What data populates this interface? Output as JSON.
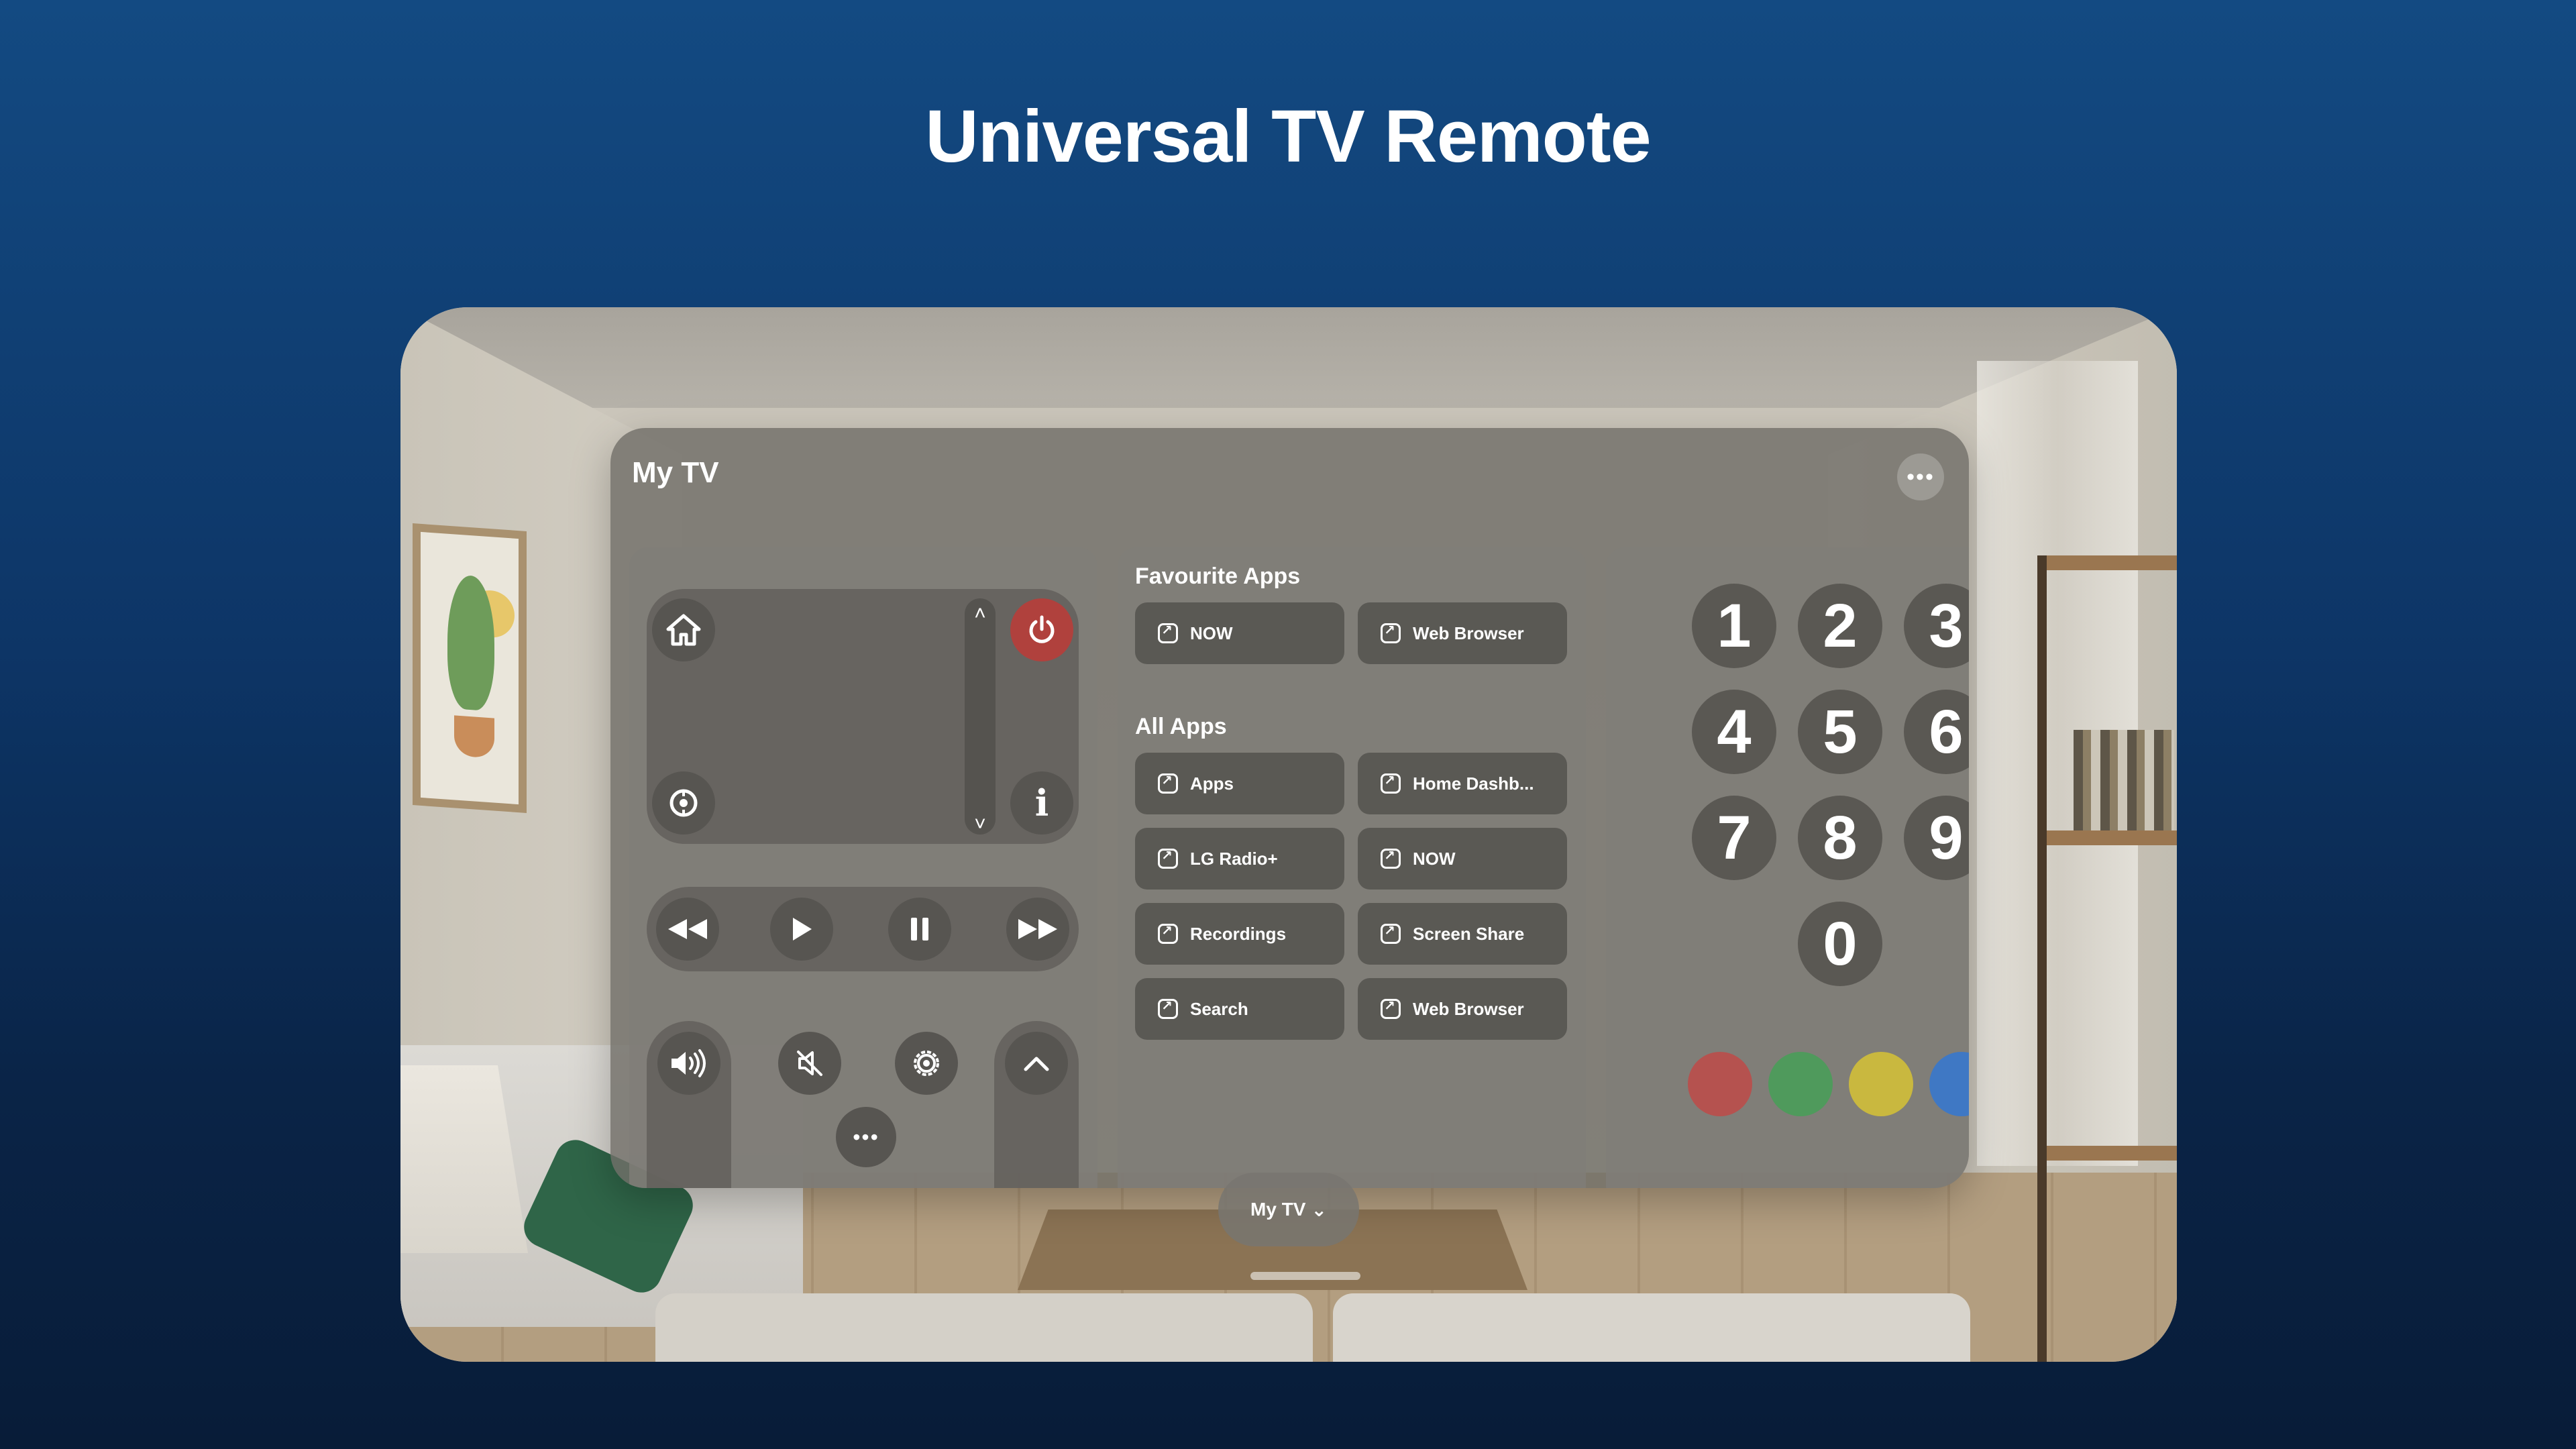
{
  "headline": "Universal TV Remote",
  "window": {
    "title": "My TV",
    "more_icon": "ellipsis-icon"
  },
  "remote": {
    "touchpad": {
      "home_icon": "home-icon",
      "power_icon": "power-icon",
      "input_icon": "input-source-icon",
      "info_icon": "info-icon",
      "channel_up_icon": "chevron-up-icon",
      "channel_down_icon": "chevron-down-icon"
    },
    "transport": [
      "rewind-icon",
      "play-icon",
      "pause-icon",
      "fast-forward-icon"
    ],
    "controls": {
      "volume_icon": "volume-icon",
      "mute_icon": "mute-icon",
      "settings_icon": "settings-icon",
      "up_icon": "chevron-up-icon",
      "more_icon": "ellipsis-icon"
    },
    "power_color": "#b0413d"
  },
  "apps": {
    "favourites_heading": "Favourite Apps",
    "favourites": [
      "NOW",
      "Web Browser"
    ],
    "all_heading": "All Apps",
    "all": [
      "Apps",
      "Home Dashb...",
      "LG Radio+",
      "NOW",
      "Recordings",
      "Screen Share",
      "Search",
      "Web Browser"
    ]
  },
  "keypad": {
    "digits": [
      "1",
      "2",
      "3",
      "4",
      "5",
      "6",
      "7",
      "8",
      "9",
      "0"
    ],
    "color_buttons": [
      {
        "name": "red",
        "color": "#b5524f"
      },
      {
        "name": "green",
        "color": "#4f9a5c"
      },
      {
        "name": "yellow",
        "color": "#c9b83f"
      },
      {
        "name": "blue",
        "color": "#3f78c4"
      }
    ]
  },
  "device_picker": {
    "label": "My TV",
    "icon": "chevron-down-icon"
  }
}
